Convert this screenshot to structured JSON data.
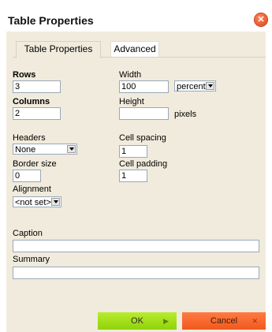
{
  "dialog": {
    "title": "Table Properties",
    "close_icon": "close-icon",
    "accent": "#e8501f"
  },
  "tabs": [
    {
      "label": "Table Properties",
      "active": true
    },
    {
      "label": "Advanced",
      "active": false
    }
  ],
  "form": {
    "rows_label": "Rows",
    "rows_value": "3",
    "columns_label": "Columns",
    "columns_value": "2",
    "width_label": "Width",
    "width_value": "100",
    "width_unit": "percent",
    "height_label": "Height",
    "height_value": "",
    "height_unit": "pixels",
    "headers_label": "Headers",
    "headers_value": "None",
    "cell_spacing_label": "Cell spacing",
    "cell_spacing_value": "1",
    "border_size_label": "Border size",
    "border_size_value": "0",
    "cell_padding_label": "Cell padding",
    "cell_padding_value": "1",
    "alignment_label": "Alignment",
    "alignment_value": "<not set>",
    "caption_label": "Caption",
    "caption_value": "",
    "summary_label": "Summary",
    "summary_value": ""
  },
  "buttons": {
    "ok_label": "OK",
    "cancel_label": "Cancel",
    "ok_color": "#9ad81a",
    "cancel_color": "#f26324"
  }
}
